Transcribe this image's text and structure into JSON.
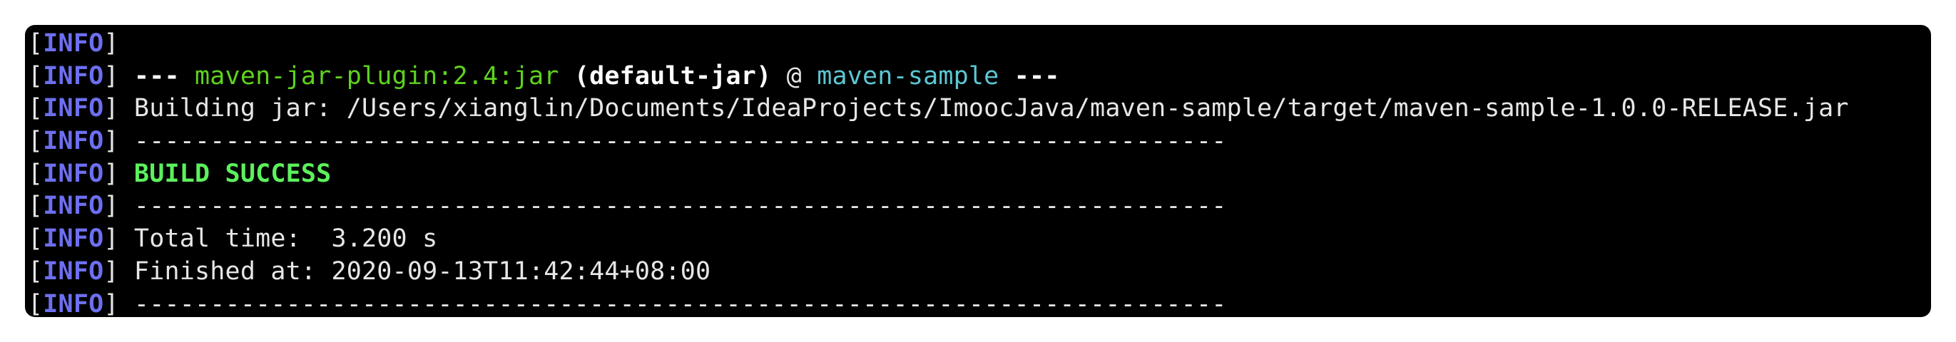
{
  "terminal": {
    "lines": [
      {
        "prefix_open": "[",
        "prefix_tag": "INFO",
        "prefix_close": "]"
      },
      {
        "prefix_open": "[",
        "prefix_tag": "INFO",
        "prefix_close": "] ",
        "dash_left": "--- ",
        "plugin": "maven-jar-plugin:2.4:jar",
        "goal": " (default-jar)",
        "at": " @ ",
        "project": "maven-sample",
        "dash_right": " ---"
      },
      {
        "prefix_open": "[",
        "prefix_tag": "INFO",
        "prefix_close": "] ",
        "text": "Building jar: /Users/xianglin/Documents/IdeaProjects/ImoocJava/maven-sample/target/maven-sample-1.0.0-RELEASE.jar"
      },
      {
        "prefix_open": "[",
        "prefix_tag": "INFO",
        "prefix_close": "] ",
        "text": "------------------------------------------------------------------------"
      },
      {
        "prefix_open": "[",
        "prefix_tag": "INFO",
        "prefix_close": "] ",
        "status": "BUILD SUCCESS"
      },
      {
        "prefix_open": "[",
        "prefix_tag": "INFO",
        "prefix_close": "] ",
        "text": "------------------------------------------------------------------------"
      },
      {
        "prefix_open": "[",
        "prefix_tag": "INFO",
        "prefix_close": "] ",
        "text": "Total time:  3.200 s"
      },
      {
        "prefix_open": "[",
        "prefix_tag": "INFO",
        "prefix_close": "] ",
        "text": "Finished at: 2020-09-13T11:42:44+08:00"
      },
      {
        "prefix_open": "[",
        "prefix_tag": "INFO",
        "prefix_close": "] ",
        "text": "------------------------------------------------------------------------"
      }
    ]
  },
  "colors": {
    "background": "#000000",
    "info_tag": "#6d6ff0",
    "plugin": "#5fd21f",
    "project": "#5cc7d3",
    "success": "#5cf15c",
    "text": "#e6e6e6"
  }
}
